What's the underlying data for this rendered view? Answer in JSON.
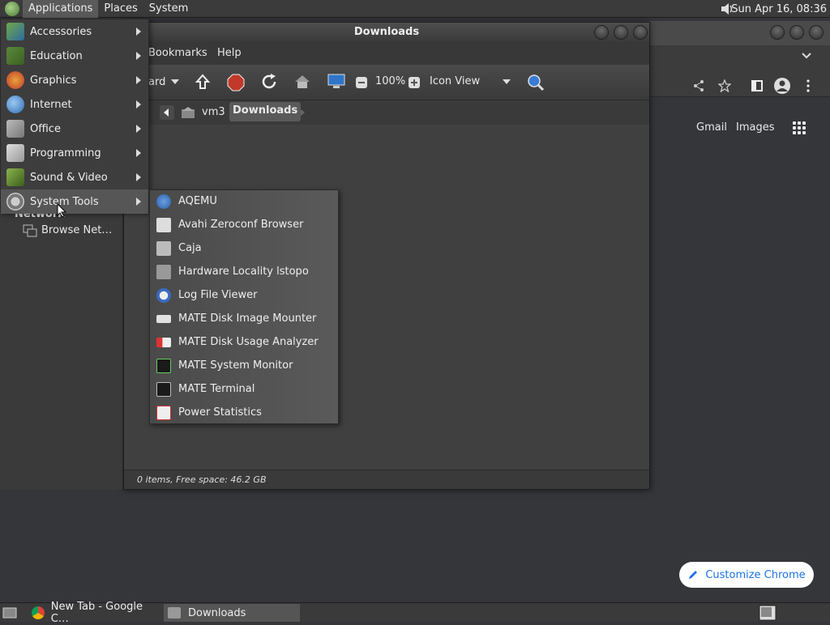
{
  "top_panel": {
    "menus": [
      "Applications",
      "Places",
      "System"
    ],
    "clock": "Sun Apr 16, 08:36"
  },
  "chrome": {
    "gmail": "Gmail",
    "images": "Images",
    "customize": "Customize Chrome"
  },
  "caja": {
    "title": "Downloads",
    "menubar": [
      "Bookmarks",
      "Help"
    ],
    "toolbar": {
      "forward_partial": "ard",
      "zoom": "100%",
      "view": "Icon View"
    },
    "path": [
      "vm3",
      "Downloads"
    ],
    "sidebar": {
      "network_header": "Network",
      "browse_net": "Browse Net…"
    },
    "status": "0 items, Free space: 46.2 GB"
  },
  "apps_menu": {
    "items": [
      {
        "label": "Accessories",
        "icon": "accessories-icon"
      },
      {
        "label": "Education",
        "icon": "education-icon"
      },
      {
        "label": "Graphics",
        "icon": "graphics-icon"
      },
      {
        "label": "Internet",
        "icon": "internet-icon"
      },
      {
        "label": "Office",
        "icon": "office-icon"
      },
      {
        "label": "Programming",
        "icon": "programming-icon"
      },
      {
        "label": "Sound & Video",
        "icon": "sound-video-icon"
      },
      {
        "label": "System Tools",
        "icon": "system-tools-icon"
      }
    ]
  },
  "system_tools_menu": {
    "items": [
      {
        "label": "AQEMU",
        "icon": "aqemu-icon"
      },
      {
        "label": "Avahi Zeroconf Browser",
        "icon": "avahi-icon"
      },
      {
        "label": "Caja",
        "icon": "caja-icon"
      },
      {
        "label": "Hardware Locality lstopo",
        "icon": "hardware-icon"
      },
      {
        "label": "Log File Viewer",
        "icon": "log-viewer-icon"
      },
      {
        "label": "MATE Disk Image Mounter",
        "icon": "disk-mounter-icon"
      },
      {
        "label": "MATE Disk Usage Analyzer",
        "icon": "disk-usage-icon"
      },
      {
        "label": "MATE System Monitor",
        "icon": "system-monitor-icon"
      },
      {
        "label": "MATE Terminal",
        "icon": "terminal-icon"
      },
      {
        "label": "Power Statistics",
        "icon": "power-stats-icon"
      }
    ]
  },
  "taskbar": {
    "tasks": [
      "New Tab - Google C…",
      "Downloads"
    ]
  }
}
